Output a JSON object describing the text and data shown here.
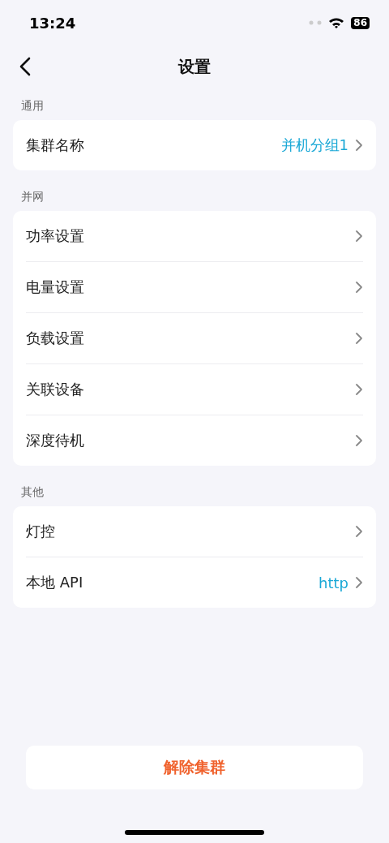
{
  "status_bar": {
    "time": "13:24",
    "battery": "86"
  },
  "header": {
    "title": "设置"
  },
  "sections": [
    {
      "title": "通用",
      "items": [
        {
          "label": "集群名称",
          "value": "并机分组1"
        }
      ]
    },
    {
      "title": "并网",
      "items": [
        {
          "label": "功率设置"
        },
        {
          "label": "电量设置"
        },
        {
          "label": "负载设置"
        },
        {
          "label": "关联设备"
        },
        {
          "label": "深度待机"
        }
      ]
    },
    {
      "title": "其他",
      "items": [
        {
          "label": "灯控"
        },
        {
          "label": "本地 API",
          "value": "http"
        }
      ]
    }
  ],
  "footer_button": "解除集群"
}
